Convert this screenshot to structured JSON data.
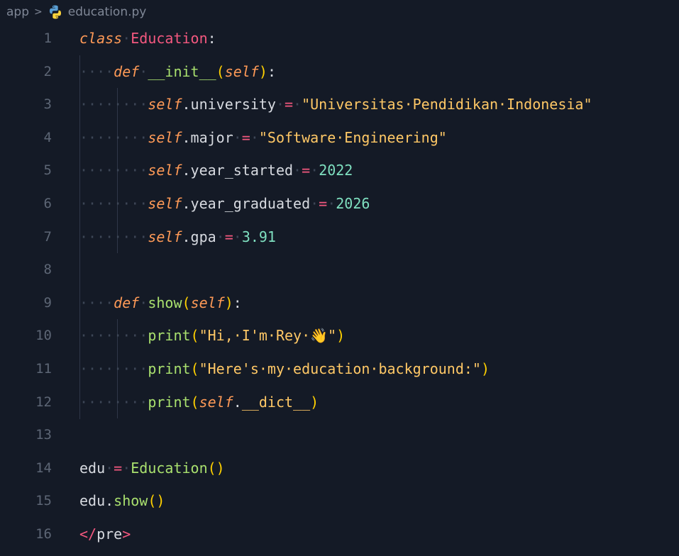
{
  "breadcrumb": {
    "folder": "app",
    "separator": ">",
    "file": "education.py",
    "file_icon": "python-icon"
  },
  "theme": {
    "background": "#141a26",
    "keyword": "#ff9a57",
    "class_name": "#f4587f",
    "function": "#a9e06e",
    "string": "#ffc866",
    "number": "#7fe0c0"
  },
  "lines": [
    {
      "n": "1",
      "tokens": [
        [
          "kw",
          "class"
        ],
        [
          "ws",
          "·"
        ],
        [
          "cls",
          "Education"
        ],
        [
          "plain",
          ":"
        ]
      ]
    },
    {
      "n": "2",
      "tokens": [
        [
          "ws",
          "····"
        ],
        [
          "kw",
          "def"
        ],
        [
          "ws",
          "·"
        ],
        [
          "fn",
          "__init__"
        ],
        [
          "p1",
          "("
        ],
        [
          "self",
          "self"
        ],
        [
          "p1",
          ")"
        ],
        [
          "plain",
          ":"
        ]
      ]
    },
    {
      "n": "3",
      "tokens": [
        [
          "ws",
          "········"
        ],
        [
          "self",
          "self"
        ],
        [
          "plain",
          ".university"
        ],
        [
          "ws",
          "·"
        ],
        [
          "op",
          "="
        ],
        [
          "ws",
          "·"
        ],
        [
          "str",
          "\"Universitas·Pendidikan·Indonesia\""
        ]
      ]
    },
    {
      "n": "4",
      "tokens": [
        [
          "ws",
          "········"
        ],
        [
          "self",
          "self"
        ],
        [
          "plain",
          ".major"
        ],
        [
          "ws",
          "·"
        ],
        [
          "op",
          "="
        ],
        [
          "ws",
          "·"
        ],
        [
          "str",
          "\"Software·Engineering\""
        ]
      ]
    },
    {
      "n": "5",
      "tokens": [
        [
          "ws",
          "········"
        ],
        [
          "self",
          "self"
        ],
        [
          "plain",
          ".year_started"
        ],
        [
          "ws",
          "·"
        ],
        [
          "op",
          "="
        ],
        [
          "ws",
          "·"
        ],
        [
          "num",
          "2022"
        ]
      ]
    },
    {
      "n": "6",
      "tokens": [
        [
          "ws",
          "········"
        ],
        [
          "self",
          "self"
        ],
        [
          "plain",
          ".year_graduated"
        ],
        [
          "ws",
          "·"
        ],
        [
          "op",
          "="
        ],
        [
          "ws",
          "·"
        ],
        [
          "num",
          "2026"
        ]
      ]
    },
    {
      "n": "7",
      "tokens": [
        [
          "ws",
          "········"
        ],
        [
          "self",
          "self"
        ],
        [
          "plain",
          ".gpa"
        ],
        [
          "ws",
          "·"
        ],
        [
          "op",
          "="
        ],
        [
          "ws",
          "·"
        ],
        [
          "num",
          "3.91"
        ]
      ]
    },
    {
      "n": "8",
      "tokens": []
    },
    {
      "n": "9",
      "tokens": [
        [
          "ws",
          "····"
        ],
        [
          "kw",
          "def"
        ],
        [
          "ws",
          "·"
        ],
        [
          "fn",
          "show"
        ],
        [
          "p1",
          "("
        ],
        [
          "self",
          "self"
        ],
        [
          "p1",
          ")"
        ],
        [
          "plain",
          ":"
        ]
      ]
    },
    {
      "n": "10",
      "tokens": [
        [
          "ws",
          "········"
        ],
        [
          "fn",
          "print"
        ],
        [
          "p1",
          "("
        ],
        [
          "str",
          "\"Hi,·I'm·Rey·👋\""
        ],
        [
          "p1",
          ")"
        ]
      ]
    },
    {
      "n": "11",
      "tokens": [
        [
          "ws",
          "········"
        ],
        [
          "fn",
          "print"
        ],
        [
          "p1",
          "("
        ],
        [
          "str",
          "\"Here's·my·education·background:\""
        ],
        [
          "p1",
          ")"
        ]
      ]
    },
    {
      "n": "12",
      "tokens": [
        [
          "ws",
          "········"
        ],
        [
          "fn",
          "print"
        ],
        [
          "p1",
          "("
        ],
        [
          "self",
          "self"
        ],
        [
          "plain",
          "."
        ],
        [
          "str",
          "__dict__"
        ],
        [
          "p1",
          ")"
        ]
      ]
    },
    {
      "n": "13",
      "tokens": []
    },
    {
      "n": "14",
      "tokens": [
        [
          "plain",
          "edu"
        ],
        [
          "ws",
          "·"
        ],
        [
          "op",
          "="
        ],
        [
          "ws",
          "·"
        ],
        [
          "fn",
          "Education"
        ],
        [
          "p1",
          "()"
        ]
      ]
    },
    {
      "n": "15",
      "tokens": [
        [
          "plain",
          "edu."
        ],
        [
          "fn",
          "show"
        ],
        [
          "p1",
          "()"
        ]
      ]
    },
    {
      "n": "16",
      "tokens": [
        [
          "tag",
          "</"
        ],
        [
          "plain",
          "pre"
        ],
        [
          "tag",
          ">"
        ]
      ]
    }
  ]
}
